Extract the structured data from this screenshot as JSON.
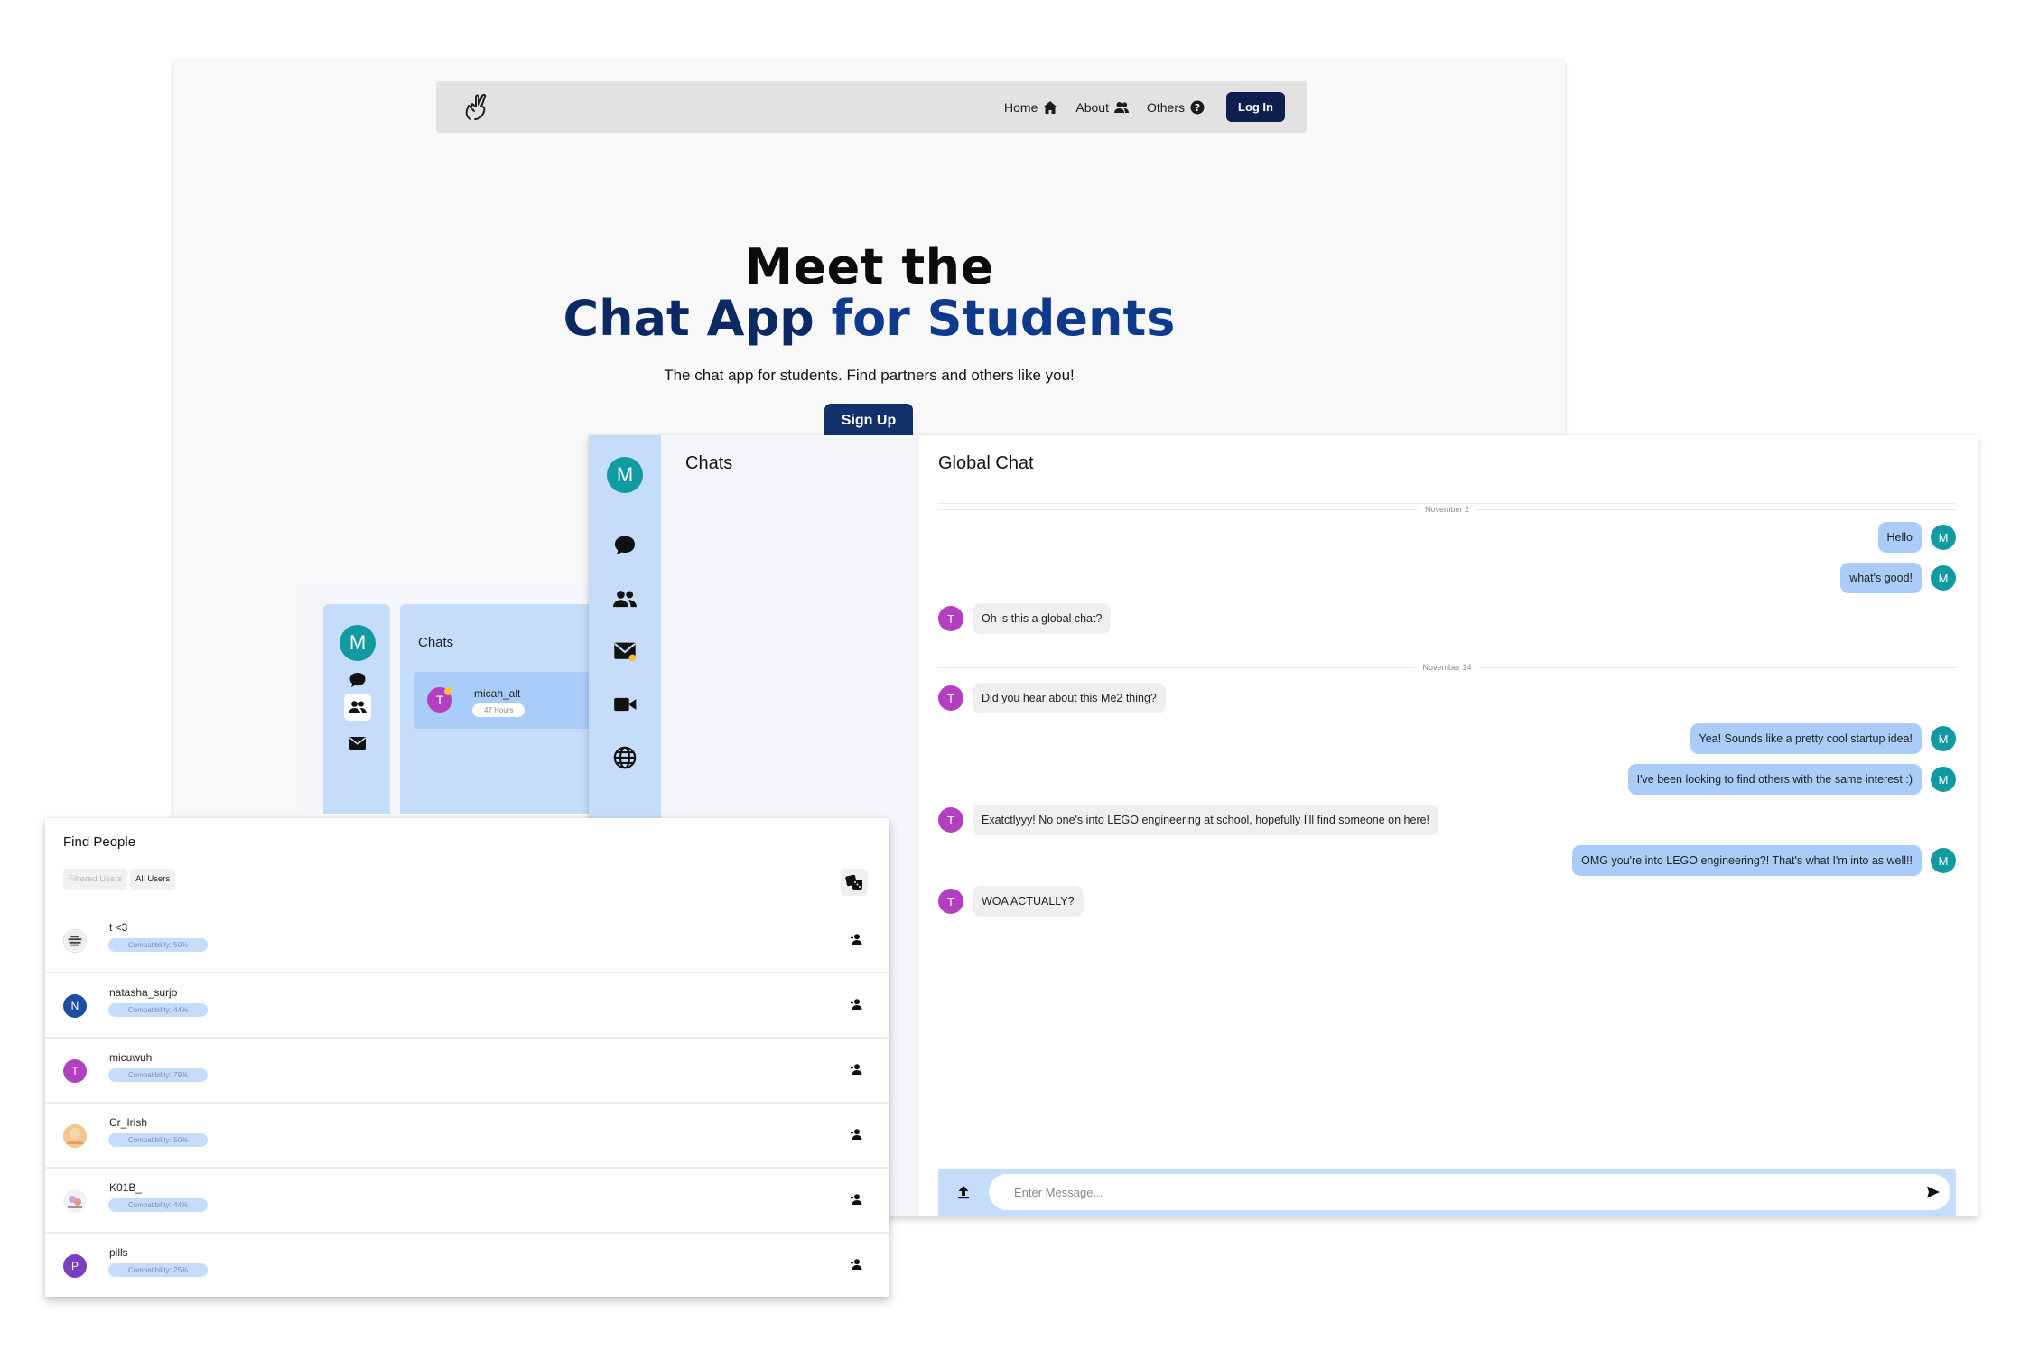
{
  "landing": {
    "nav": {
      "links": [
        {
          "label": "Home",
          "icon": "home-icon"
        },
        {
          "label": "About",
          "icon": "users-icon"
        },
        {
          "label": "Others",
          "icon": "question-circle-icon"
        }
      ],
      "login_label": "Log In"
    },
    "hero": {
      "line1": "Meet the",
      "line2_part1": "Chat App ",
      "line2_part2": "for Students",
      "subtitle": "The chat app for students. Find partners and others like you!",
      "signup_label": "Sign Up"
    }
  },
  "mini_app": {
    "avatar_letter": "M",
    "chats_title": "Chats",
    "chat_item": {
      "avatar_letter": "T",
      "name": "micah_alt",
      "badge": "47 Hours"
    }
  },
  "chat_app": {
    "avatar_letter": "M",
    "rail_icons": [
      "chat-bubble-icon",
      "people-icon",
      "mail-icon",
      "video-icon",
      "globe-icon"
    ],
    "chats_title": "Chats",
    "conversation_title": "Global Chat",
    "date_separators": [
      "November 2",
      "November 14"
    ],
    "messages": [
      {
        "dir": "out",
        "author": "M",
        "text": "Hello"
      },
      {
        "dir": "out",
        "author": "M",
        "text": "what's good!"
      },
      {
        "dir": "in",
        "author": "T",
        "text": "Oh is this a global chat?"
      },
      {
        "dir": "in",
        "author": "T",
        "text": "Did you hear about this Me2 thing?"
      },
      {
        "dir": "out",
        "author": "M",
        "text": "Yea! Sounds like a pretty cool startup idea!"
      },
      {
        "dir": "out",
        "author": "M",
        "text": "I've been looking to find others with the same interest :)"
      },
      {
        "dir": "in",
        "author": "T",
        "text": "Exatctlyyy! No one's into LEGO engineering at school, hopefully I'll find someone on here!"
      },
      {
        "dir": "out",
        "author": "M",
        "text": "OMG you're into LEGO engineering?! That's what I'm into as well!!"
      },
      {
        "dir": "in",
        "author": "T",
        "text": "WOA ACTUALLY?"
      }
    ],
    "composer": {
      "placeholder": "Enter Message..."
    }
  },
  "find_people": {
    "title": "Find People",
    "tabs": [
      "Filtered Users",
      "All Users"
    ],
    "people": [
      {
        "name": "t <3",
        "compat": "Compatibility: 50%",
        "avatar": "photo",
        "color": "#555555",
        "letter": ""
      },
      {
        "name": "natasha_surjo",
        "compat": "Compatibility: 44%",
        "avatar": "letter",
        "color": "#1d4fa0",
        "letter": "N"
      },
      {
        "name": "micuwuh",
        "compat": "Compatibility: 79%",
        "avatar": "letter",
        "color": "#b13fbf",
        "letter": "T"
      },
      {
        "name": "Cr_Irish",
        "compat": "Compatibility: 50%",
        "avatar": "photo",
        "color": "#e9b46a",
        "letter": ""
      },
      {
        "name": "K01B_",
        "compat": "Compatibility: 44%",
        "avatar": "photo",
        "color": "#c9a9d6",
        "letter": ""
      },
      {
        "name": "pills",
        "compat": "Compatibility: 25%",
        "avatar": "letter",
        "color": "#7a3fbf",
        "letter": "P"
      }
    ]
  }
}
